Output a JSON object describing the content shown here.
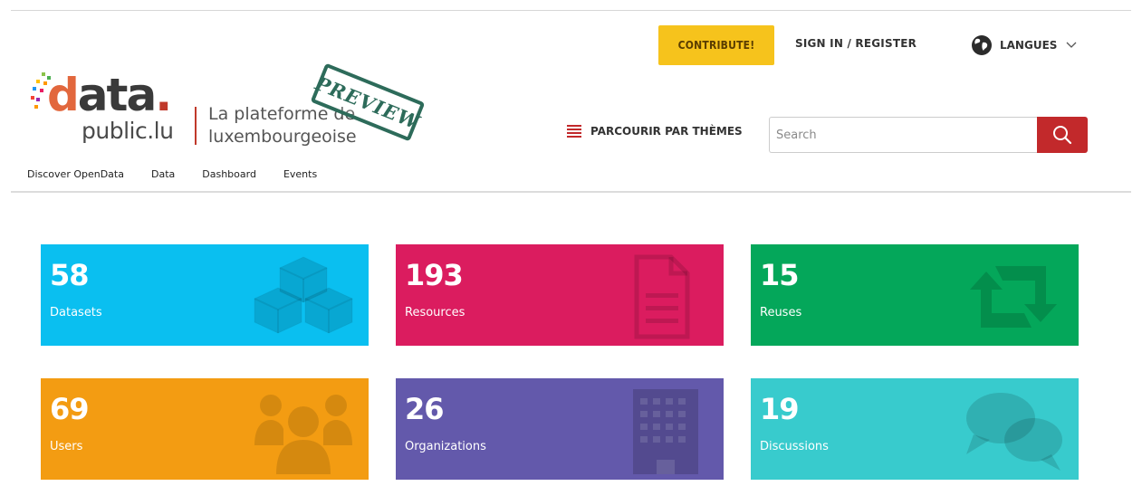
{
  "header": {
    "contribute_label": "CONTRIBUTE!",
    "signin_label": "SIGN IN / REGISTER",
    "langues_label": "LANGUES",
    "themes_label": "PARCOURIR PAR THÈMES",
    "search_placeholder": "Search"
  },
  "logo": {
    "data_prefix": "d",
    "data_rest": "ata",
    "data_dot": ".",
    "public": "public.lu",
    "tagline_line1": "La plateforme de",
    "tagline_line2": "luxembourgeoise",
    "stamp": "PREVIEW"
  },
  "nav": [
    "Discover OpenData",
    "Data",
    "Dashboard",
    "Events"
  ],
  "stats": [
    {
      "value": "58",
      "label": "Datasets",
      "icon": "cubes-icon",
      "color": "#0abff0"
    },
    {
      "value": "193",
      "label": "Resources",
      "icon": "document-icon",
      "color": "#db1c5f"
    },
    {
      "value": "15",
      "label": "Reuses",
      "icon": "retweet-icon",
      "color": "#04a75a"
    },
    {
      "value": "69",
      "label": "Users",
      "icon": "users-icon",
      "color": "#f39c12"
    },
    {
      "value": "26",
      "label": "Organizations",
      "icon": "building-icon",
      "color": "#6359ab"
    },
    {
      "value": "19",
      "label": "Discussions",
      "icon": "chat-bubbles-icon",
      "color": "#38cbcd"
    }
  ],
  "colors": {
    "contribute_bg": "#f6c31c",
    "search_button": "#c2292b",
    "logo_accent": "#c0392b"
  }
}
